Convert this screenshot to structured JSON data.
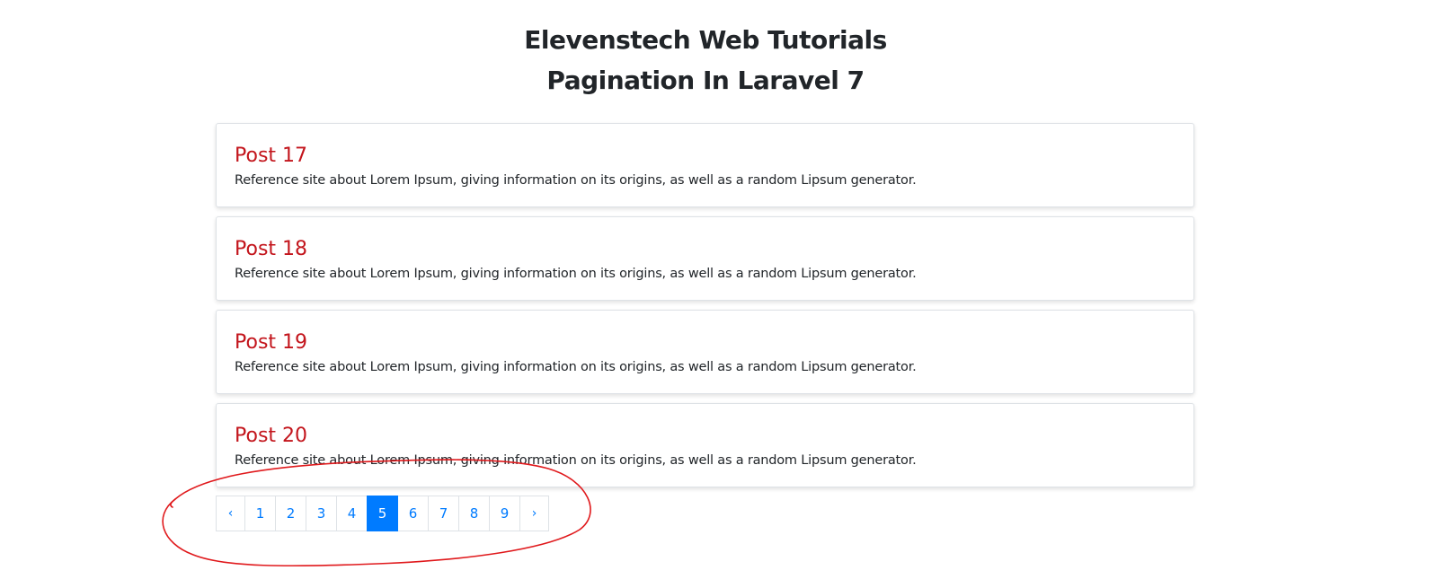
{
  "header": {
    "line1": "Elevenstech Web Tutorials",
    "line2": "Pagination In Laravel 7"
  },
  "posts": [
    {
      "title": "Post 17",
      "body": "Reference site about Lorem Ipsum, giving information on its origins, as well as a random Lipsum generator."
    },
    {
      "title": "Post 18",
      "body": "Reference site about Lorem Ipsum, giving information on its origins, as well as a random Lipsum generator."
    },
    {
      "title": "Post 19",
      "body": "Reference site about Lorem Ipsum, giving information on its origins, as well as a random Lipsum generator."
    },
    {
      "title": "Post 20",
      "body": "Reference site about Lorem Ipsum, giving information on its origins, as well as a random Lipsum generator."
    }
  ],
  "pagination": {
    "prev": "‹",
    "pages": [
      "1",
      "2",
      "3",
      "4",
      "5",
      "6",
      "7",
      "8",
      "9"
    ],
    "active_page": "5",
    "next": "›"
  },
  "colors": {
    "post_title": "#c3151c",
    "link": "#007bff",
    "active_bg": "#007bff",
    "annotation": "#e0191c"
  }
}
